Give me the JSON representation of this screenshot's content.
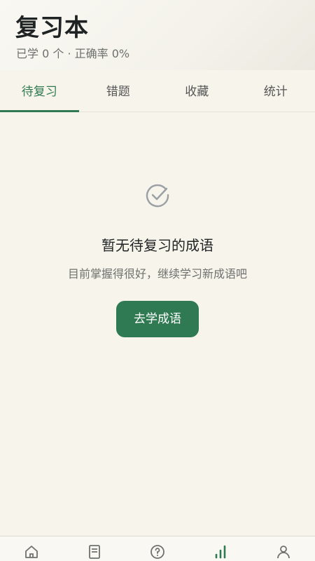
{
  "header": {
    "title": "复习本",
    "subtitle": "已学 0 个 · 正确率 0%"
  },
  "tabs": [
    {
      "label": "待复习",
      "active": true
    },
    {
      "label": "错题",
      "active": false
    },
    {
      "label": "收藏",
      "active": false
    },
    {
      "label": "统计",
      "active": false
    }
  ],
  "empty_state": {
    "icon": "check-circle-icon",
    "title": "暂无待复习的成语",
    "description": "目前掌握得很好，继续学习新成语吧",
    "button_label": "去学成语"
  },
  "bottom_nav": {
    "items": [
      {
        "icon": "home-icon"
      },
      {
        "icon": "book-icon"
      },
      {
        "icon": "question-icon"
      },
      {
        "icon": "stats-icon",
        "active": true
      },
      {
        "icon": "profile-icon"
      }
    ]
  },
  "colors": {
    "accent": "#2f7a52",
    "background": "#f7f4ec",
    "muted_text": "#6e716d"
  }
}
